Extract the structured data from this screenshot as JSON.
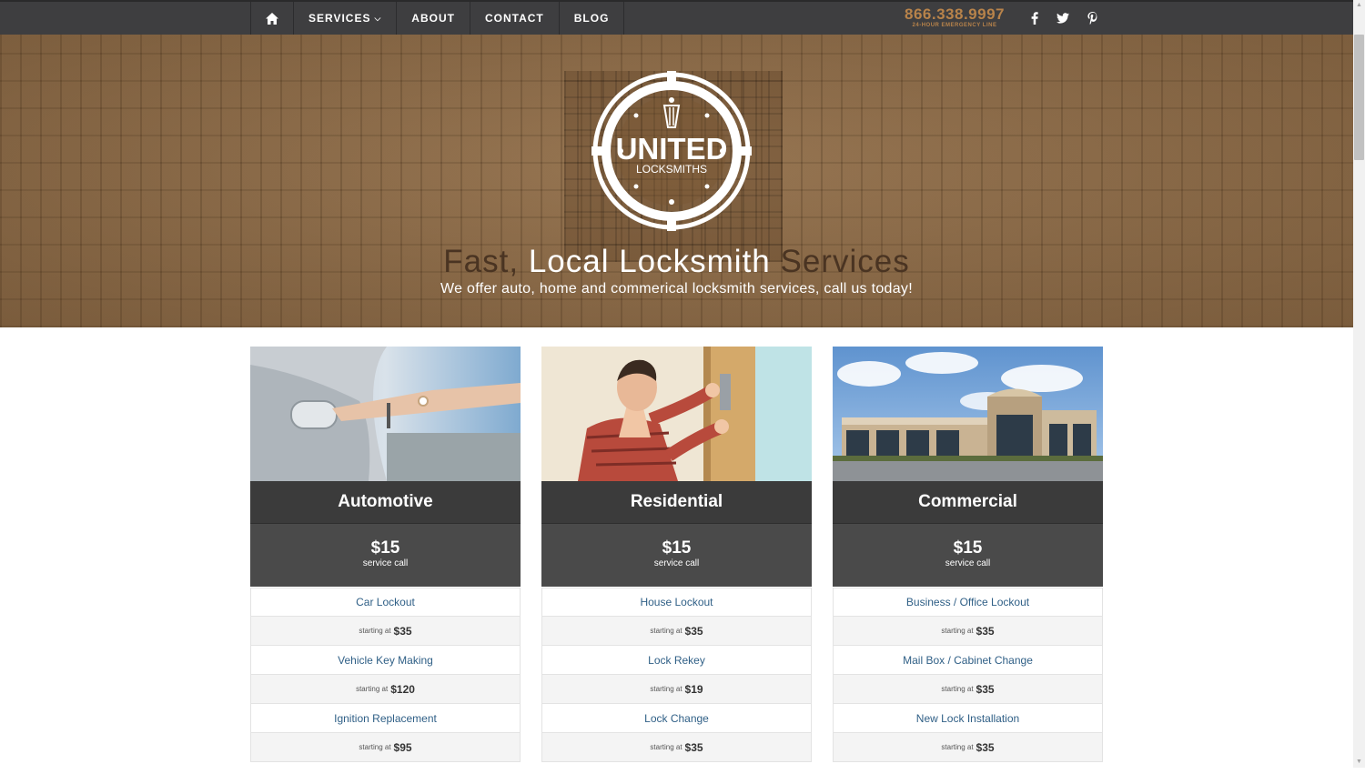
{
  "nav": {
    "items": [
      {
        "label": "SERVICES",
        "has_dropdown": true
      },
      {
        "label": "ABOUT"
      },
      {
        "label": "CONTACT"
      },
      {
        "label": "BLOG"
      }
    ],
    "phone": "866.338.9997",
    "phone_sub": "24-HOUR EMERGENCY LINE",
    "social_icons": [
      "facebook-icon",
      "twitter-icon",
      "pinterest-icon"
    ]
  },
  "hero": {
    "logo_title": "UNITED",
    "logo_subtitle": "LOCKSMITHS",
    "headline": {
      "part1": "Fast,",
      "part2": "Local Locksmith",
      "part3": "Services"
    },
    "subheadline": "We offer auto, home and commerical locksmith services, call us today!"
  },
  "cards": [
    {
      "title": "Automotive",
      "price": "$15",
      "price_label": "service call",
      "services": [
        {
          "name": "Car Lockout",
          "prefix": "starting at",
          "price": "$35"
        },
        {
          "name": "Vehicle Key Making",
          "prefix": "starting at",
          "price": "$120"
        },
        {
          "name": "Ignition Replacement",
          "prefix": "starting at",
          "price": "$95"
        }
      ]
    },
    {
      "title": "Residential",
      "price": "$15",
      "price_label": "service call",
      "services": [
        {
          "name": "House Lockout",
          "prefix": "starting at",
          "price": "$35"
        },
        {
          "name": "Lock Rekey",
          "prefix": "starting at",
          "price": "$19"
        },
        {
          "name": "Lock Change",
          "prefix": "starting at",
          "price": "$35"
        }
      ]
    },
    {
      "title": "Commercial",
      "price": "$15",
      "price_label": "service call",
      "services": [
        {
          "name": "Business / Office Lockout",
          "prefix": "starting at",
          "price": "$35"
        },
        {
          "name": "Mail Box / Cabinet Change",
          "prefix": "starting at",
          "price": "$35"
        },
        {
          "name": "New Lock Installation",
          "prefix": "starting at",
          "price": "$35"
        }
      ]
    }
  ],
  "colors": {
    "nav_bg": "#3e3e40",
    "accent": "#b8834a",
    "card_title_bg": "#3b3b3b",
    "card_price_bg": "#4a4a4a",
    "link": "#2f5f86"
  }
}
